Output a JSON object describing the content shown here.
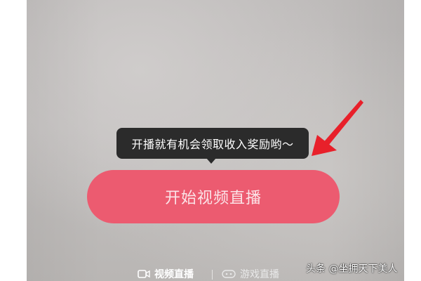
{
  "tooltip": {
    "text": "开播就有机会领取收入奖励哟～"
  },
  "start_button": {
    "label": "开始视频直播"
  },
  "mode_tabs": [
    {
      "label": "视频直播",
      "icon": "video-camera-icon",
      "selected": true
    },
    {
      "label": "游戏直播",
      "icon": "gamepad-icon",
      "selected": false
    }
  ],
  "watermark": {
    "text": "头条 @坐拥天下美人"
  },
  "colors": {
    "button": "#ec5b70",
    "tooltip_bg": "#2b2b2b",
    "arrow": "#e8202a",
    "preview_bg": "#bebbba"
  }
}
